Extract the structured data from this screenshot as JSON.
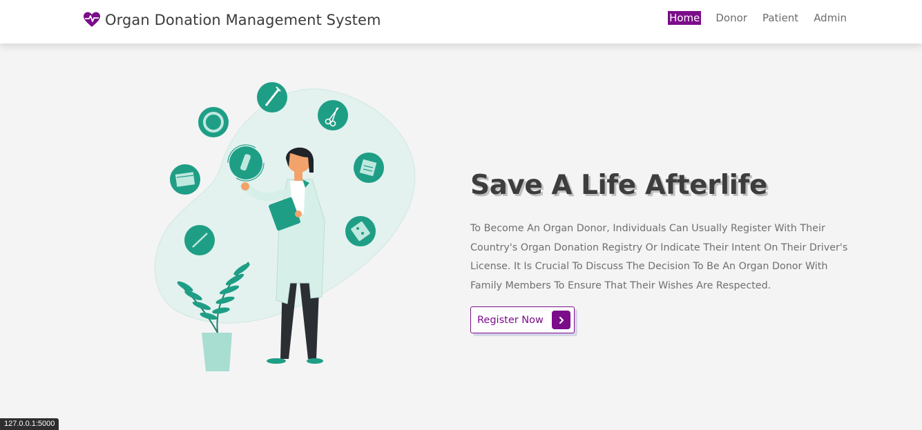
{
  "navbar": {
    "brand_icon": "heart-pulse-icon",
    "brand_title": "Organ Donation Management System",
    "links": [
      {
        "label": "Home",
        "active": true
      },
      {
        "label": "Donor",
        "active": false
      },
      {
        "label": "Patient",
        "active": false
      },
      {
        "label": "Admin",
        "active": false
      }
    ]
  },
  "hero": {
    "title": "Save A Life Afterlife",
    "description": "To Become An Organ Donor, Individuals Can Usually Register With Their Country's Organ Donation Registry Or Indicate Their Intent On Their Driver's License. It Is Crucial To Discuss The Decision To Be An Organ Donor With Family Members To Ensure That Their Wishes Are Respected.",
    "cta_label": "Register Now",
    "cta_icon": "chevron-right-icon",
    "illustration_icons": [
      "syringe-icon",
      "scissors-icon",
      "ring-icon",
      "vial-icon",
      "calendar-icon",
      "notepad-icon",
      "pill-pack-icon",
      "thermometer-icon"
    ]
  },
  "status_bar": {
    "url": "127.0.0.1:5000"
  },
  "colors": {
    "accent": "#7b0d8a",
    "teal": "#1f9e86",
    "background": "#f4f4f4"
  }
}
